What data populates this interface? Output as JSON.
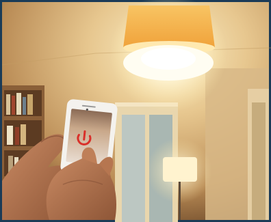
{
  "scene": {
    "subject": "smart-home-lighting-control",
    "app_screen": {
      "power_icon": "power-icon",
      "power_color": "#d9302a"
    },
    "colors": {
      "border": "#1b3b57",
      "wall_warm": "#d2b07a",
      "ceiling_glow": "#f7e3a8",
      "lamp_shade": "#f6b24a",
      "bulb_glow": "#fff8dc",
      "skin": "#b27452"
    }
  }
}
